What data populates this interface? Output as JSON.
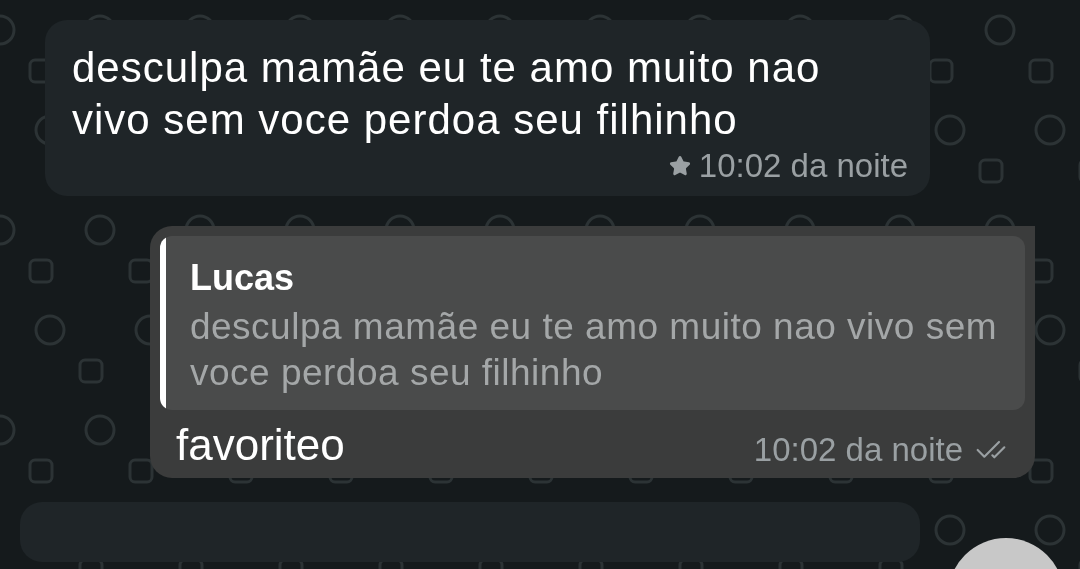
{
  "messages": [
    {
      "kind": "incoming",
      "text": "desculpa mamãe eu te amo muito nao vivo sem voce perdoa seu filhinho",
      "time": "10:02 da noite",
      "starred": true
    },
    {
      "kind": "outgoing",
      "quote": {
        "author": "Lucas",
        "text": "desculpa mamãe eu te amo muito nao vivo sem voce perdoa seu filhinho"
      },
      "text": "favoriteo",
      "time": "10:02 da noite",
      "starred": false,
      "read": false
    },
    {
      "kind": "cutoff"
    }
  ]
}
